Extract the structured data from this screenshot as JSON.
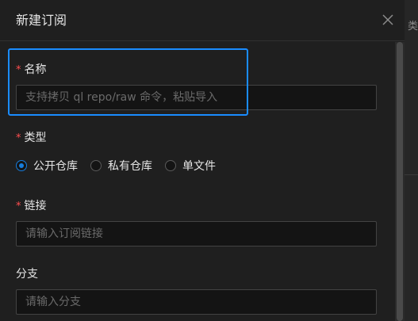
{
  "modal": {
    "title": "新建订阅",
    "close_label": "close"
  },
  "form": {
    "name": {
      "required_mark": "*",
      "label": "名称",
      "placeholder": "支持拷贝 ql repo/raw 命令，粘贴导入",
      "value": ""
    },
    "type": {
      "required_mark": "*",
      "label": "类型",
      "options": [
        {
          "label": "公开仓库",
          "checked": true
        },
        {
          "label": "私有仓库",
          "checked": false
        },
        {
          "label": "单文件",
          "checked": false
        }
      ]
    },
    "link": {
      "required_mark": "*",
      "label": "链接",
      "placeholder": "请输入订阅链接",
      "value": ""
    },
    "branch": {
      "label": "分支",
      "placeholder": "请输入分支",
      "value": ""
    }
  },
  "background": {
    "side_text": "类"
  },
  "colors": {
    "accent": "#177ddc",
    "focus": "#1a8cff",
    "required": "#ff4d4f"
  }
}
